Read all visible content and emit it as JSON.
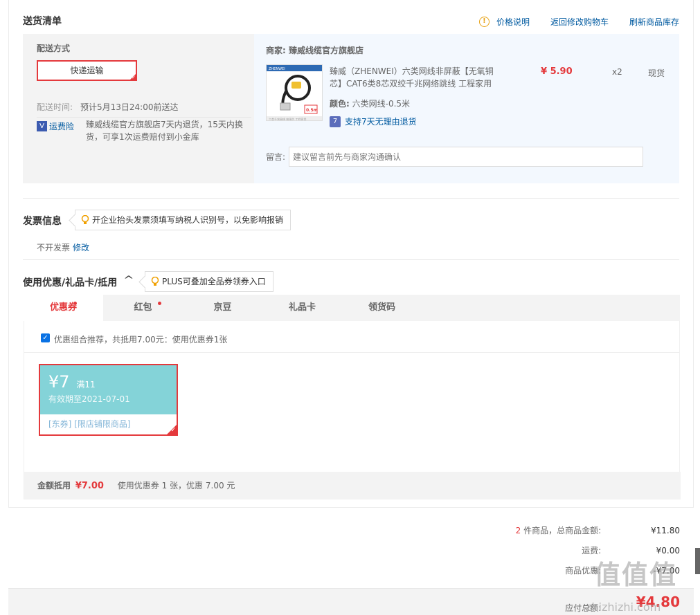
{
  "delivery": {
    "title": "送货清单",
    "links": {
      "price_note": "价格说明",
      "back_cart": "返回修改购物车",
      "refresh_stock": "刷新商品库存"
    },
    "method_label": "配送方式",
    "method_value": "快递运输",
    "time_label": "配送时间:",
    "time_value": "预计5月13日24:00前送达",
    "insurance_label": "运费险",
    "insurance_text": "臻威线缆官方旗舰店7天内退货，15天内换货，可享1次运费赔付到小金库"
  },
  "shop": {
    "label": "商家:",
    "name": "臻威线缆官方旗舰店",
    "product": {
      "title": "臻威（ZHENWEI）六类网线非屏蔽【无氧铜芯】CAT6类8芯双绞千兆网络跳线 工程家用",
      "price": "¥ 5.90",
      "qty": "x2",
      "stock": "现货",
      "color_label": "颜色:",
      "color_value": "六类网线-0.5米",
      "return_policy": "支持7天无理由退货",
      "thumb_brand": "ZHENWEI",
      "thumb_badge": "0.5m",
      "thumb_caption": "六类千兆网线 纯铜芯 工程家用"
    },
    "remark_label": "留言:",
    "remark_placeholder": "建议留言前先与商家沟通确认"
  },
  "invoice": {
    "title": "发票信息",
    "tip": "开企业抬头发票须填写纳税人识别号，以免影响报销",
    "status": "不开发票",
    "edit": "修改"
  },
  "discount": {
    "title": "使用优惠/礼品卡/抵用",
    "toggle": "^",
    "tip": "PLUS可叠加全品券领券入口",
    "tabs": [
      {
        "label": "优惠券",
        "dot": true
      },
      {
        "label": "红包",
        "dot": true
      },
      {
        "label": "京豆",
        "dot": false
      },
      {
        "label": "礼品卡",
        "dot": false
      },
      {
        "label": "领货码",
        "dot": false
      }
    ],
    "combo_text": "优惠组合推荐，共抵用7.00元：使用优惠券1张",
    "coupon": {
      "amount": "¥7",
      "condition": "满11",
      "expiry": "有效期至2021-07-01",
      "tags": "[东券]  [限店铺限商品]"
    },
    "deduct_label": "金额抵用",
    "deduct_value": "¥7.00",
    "deduct_note": "使用优惠券 1 张，优惠 7.00 元"
  },
  "summary": {
    "count": "2",
    "count_label": "件商品，总商品金额:",
    "total": "¥11.80",
    "shipping_label": "运费:",
    "shipping": "¥0.00",
    "discount_label": "商品优惠:",
    "discount": "-¥7.00",
    "pay_label": "应付总额:",
    "pay": "¥4.80"
  },
  "watermark": {
    "logo": "值值值",
    "url": "zhizhizhi.com"
  },
  "colors": {
    "accent": "#e4393c",
    "link": "#005aa0",
    "coupon": "#84d3d8"
  }
}
